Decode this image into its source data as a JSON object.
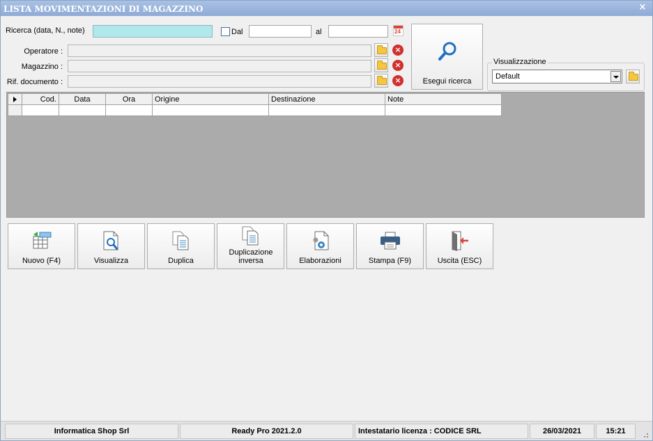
{
  "window": {
    "title": "LISTA MOVIMENTAZIONI DI MAGAZZINO",
    "close_glyph": "×"
  },
  "search": {
    "label": "Ricerca (data, N., note)",
    "value": "",
    "dal_label": "Dal",
    "dal_checked": false,
    "dal_value": "",
    "al_label": "al",
    "al_value": "",
    "calendar_day": "24"
  },
  "filters": [
    {
      "label": "Operatore :",
      "value": ""
    },
    {
      "label": "Magazzino :",
      "value": ""
    },
    {
      "label": "Rif. documento :",
      "value": ""
    }
  ],
  "search_button": {
    "label": "Esegui ricerca"
  },
  "visualizzazione": {
    "label": "Visualizzazione",
    "selected": "Default"
  },
  "grid": {
    "columns": [
      "Cod.",
      "Data",
      "Ora",
      "Origine",
      "Destinazione",
      "Note"
    ],
    "rows": [
      [
        "",
        "",
        "",
        "",
        "",
        ""
      ]
    ]
  },
  "actions": [
    {
      "label": "Nuovo (F4)",
      "icon": "new-row-icon"
    },
    {
      "label": "Visualizza",
      "icon": "view-document-icon"
    },
    {
      "label": "Duplica",
      "icon": "duplicate-icon"
    },
    {
      "label": "Duplicazione inversa",
      "icon": "reverse-duplicate-icon"
    },
    {
      "label": "Elaborazioni",
      "icon": "process-gear-icon"
    },
    {
      "label": "Stampa (F9)",
      "icon": "printer-icon"
    },
    {
      "label": "Uscita (ESC)",
      "icon": "exit-door-icon"
    }
  ],
  "status": {
    "company": "Informatica Shop Srl",
    "version": "Ready Pro 2021.2.0",
    "license": "Intestatario licenza : CODICE SRL",
    "date": "26/03/2021",
    "time": "15:21"
  },
  "colors": {
    "title_bar": "#8eabd6",
    "search_highlight": "#b1e8ec",
    "grid_background": "#ababab",
    "delete_red": "#d22f2f",
    "folder_yellow": "#f4c73e"
  }
}
